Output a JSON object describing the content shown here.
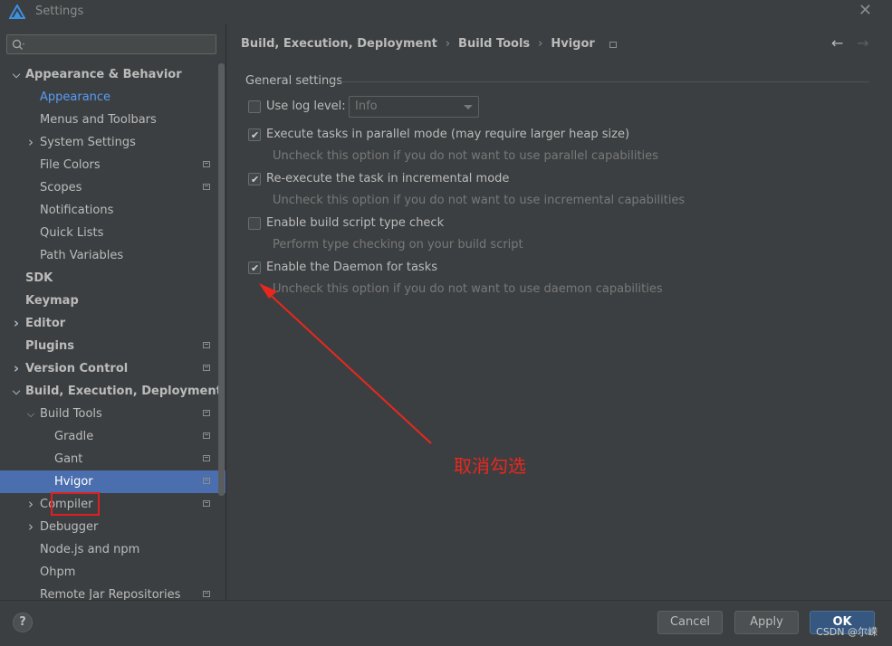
{
  "window": {
    "title": "Settings",
    "icons": {
      "app": "app-logo-icon",
      "close": "close-icon"
    }
  },
  "sidebar": {
    "search": {
      "placeholder": "",
      "icon": "search-icon"
    },
    "items": [
      {
        "label": "Appearance & Behavior",
        "level": 0,
        "bold": true,
        "chevron": "expanded"
      },
      {
        "label": "Appearance",
        "level": 1,
        "link": true
      },
      {
        "label": "Menus and Toolbars",
        "level": 1
      },
      {
        "label": "System Settings",
        "level": 1,
        "chevron": "collapsed"
      },
      {
        "label": "File Colors",
        "level": 1,
        "project_icon": true
      },
      {
        "label": "Scopes",
        "level": 1,
        "project_icon": true
      },
      {
        "label": "Notifications",
        "level": 1
      },
      {
        "label": "Quick Lists",
        "level": 1
      },
      {
        "label": "Path Variables",
        "level": 1
      },
      {
        "label": "SDK",
        "level": 0,
        "bold": true
      },
      {
        "label": "Keymap",
        "level": 0,
        "bold": true
      },
      {
        "label": "Editor",
        "level": 0,
        "bold": true,
        "chevron": "collapsed"
      },
      {
        "label": "Plugins",
        "level": 0,
        "bold": true,
        "project_icon": true
      },
      {
        "label": "Version Control",
        "level": 0,
        "bold": true,
        "chevron": "collapsed",
        "project_icon": true
      },
      {
        "label": "Build, Execution, Deployment",
        "level": 0,
        "bold": true,
        "chevron": "expanded"
      },
      {
        "label": "Build Tools",
        "level": 1,
        "chevron": "expanded",
        "project_icon": true
      },
      {
        "label": "Gradle",
        "level": 2,
        "project_icon": true
      },
      {
        "label": "Gant",
        "level": 2,
        "project_icon": true
      },
      {
        "label": "Hvigor",
        "level": 2,
        "project_icon": true,
        "selected": true
      },
      {
        "label": "Compiler",
        "level": 1,
        "chevron": "collapsed",
        "project_icon": true
      },
      {
        "label": "Debugger",
        "level": 1,
        "chevron": "collapsed"
      },
      {
        "label": "Node.js and npm",
        "level": 1
      },
      {
        "label": "Ohpm",
        "level": 1
      },
      {
        "label": "Remote Jar Repositories",
        "level": 1,
        "project_icon": true
      }
    ]
  },
  "breadcrumb": {
    "parts": [
      "Build, Execution, Deployment",
      "Build Tools",
      "Hvigor"
    ],
    "separator": "›",
    "scope_icon": "project-scope-icon"
  },
  "nav": {
    "back": "←",
    "forward": "→"
  },
  "settings": {
    "group_title": "General settings",
    "log_level": {
      "label": "Use log level:",
      "checked": false,
      "value": "Info"
    },
    "options": [
      {
        "label": "Execute tasks in parallel mode (may require larger heap size)",
        "checked": true,
        "hint": "Uncheck this option if you do not want to use parallel capabilities"
      },
      {
        "label": "Re-execute the task in incremental mode",
        "checked": true,
        "hint": "Uncheck this option if you do not want to use incremental capabilities"
      },
      {
        "label": "Enable build script type check",
        "checked": false,
        "hint": "Perform type checking on your build script"
      },
      {
        "label": "Enable the Daemon for tasks",
        "checked": true,
        "hint": "Uncheck this option if you do not want to use daemon capabilities"
      }
    ]
  },
  "annotation": {
    "text": "取消勾选",
    "color": "#e8281e"
  },
  "footer": {
    "help": "?",
    "cancel": "Cancel",
    "apply": "Apply",
    "ok": "OK"
  },
  "watermark": "CSDN @尔嵘",
  "colors": {
    "accent": "#4b6eaf",
    "link": "#589df6",
    "primary_button": "#365880",
    "annotation": "#e8281e"
  }
}
